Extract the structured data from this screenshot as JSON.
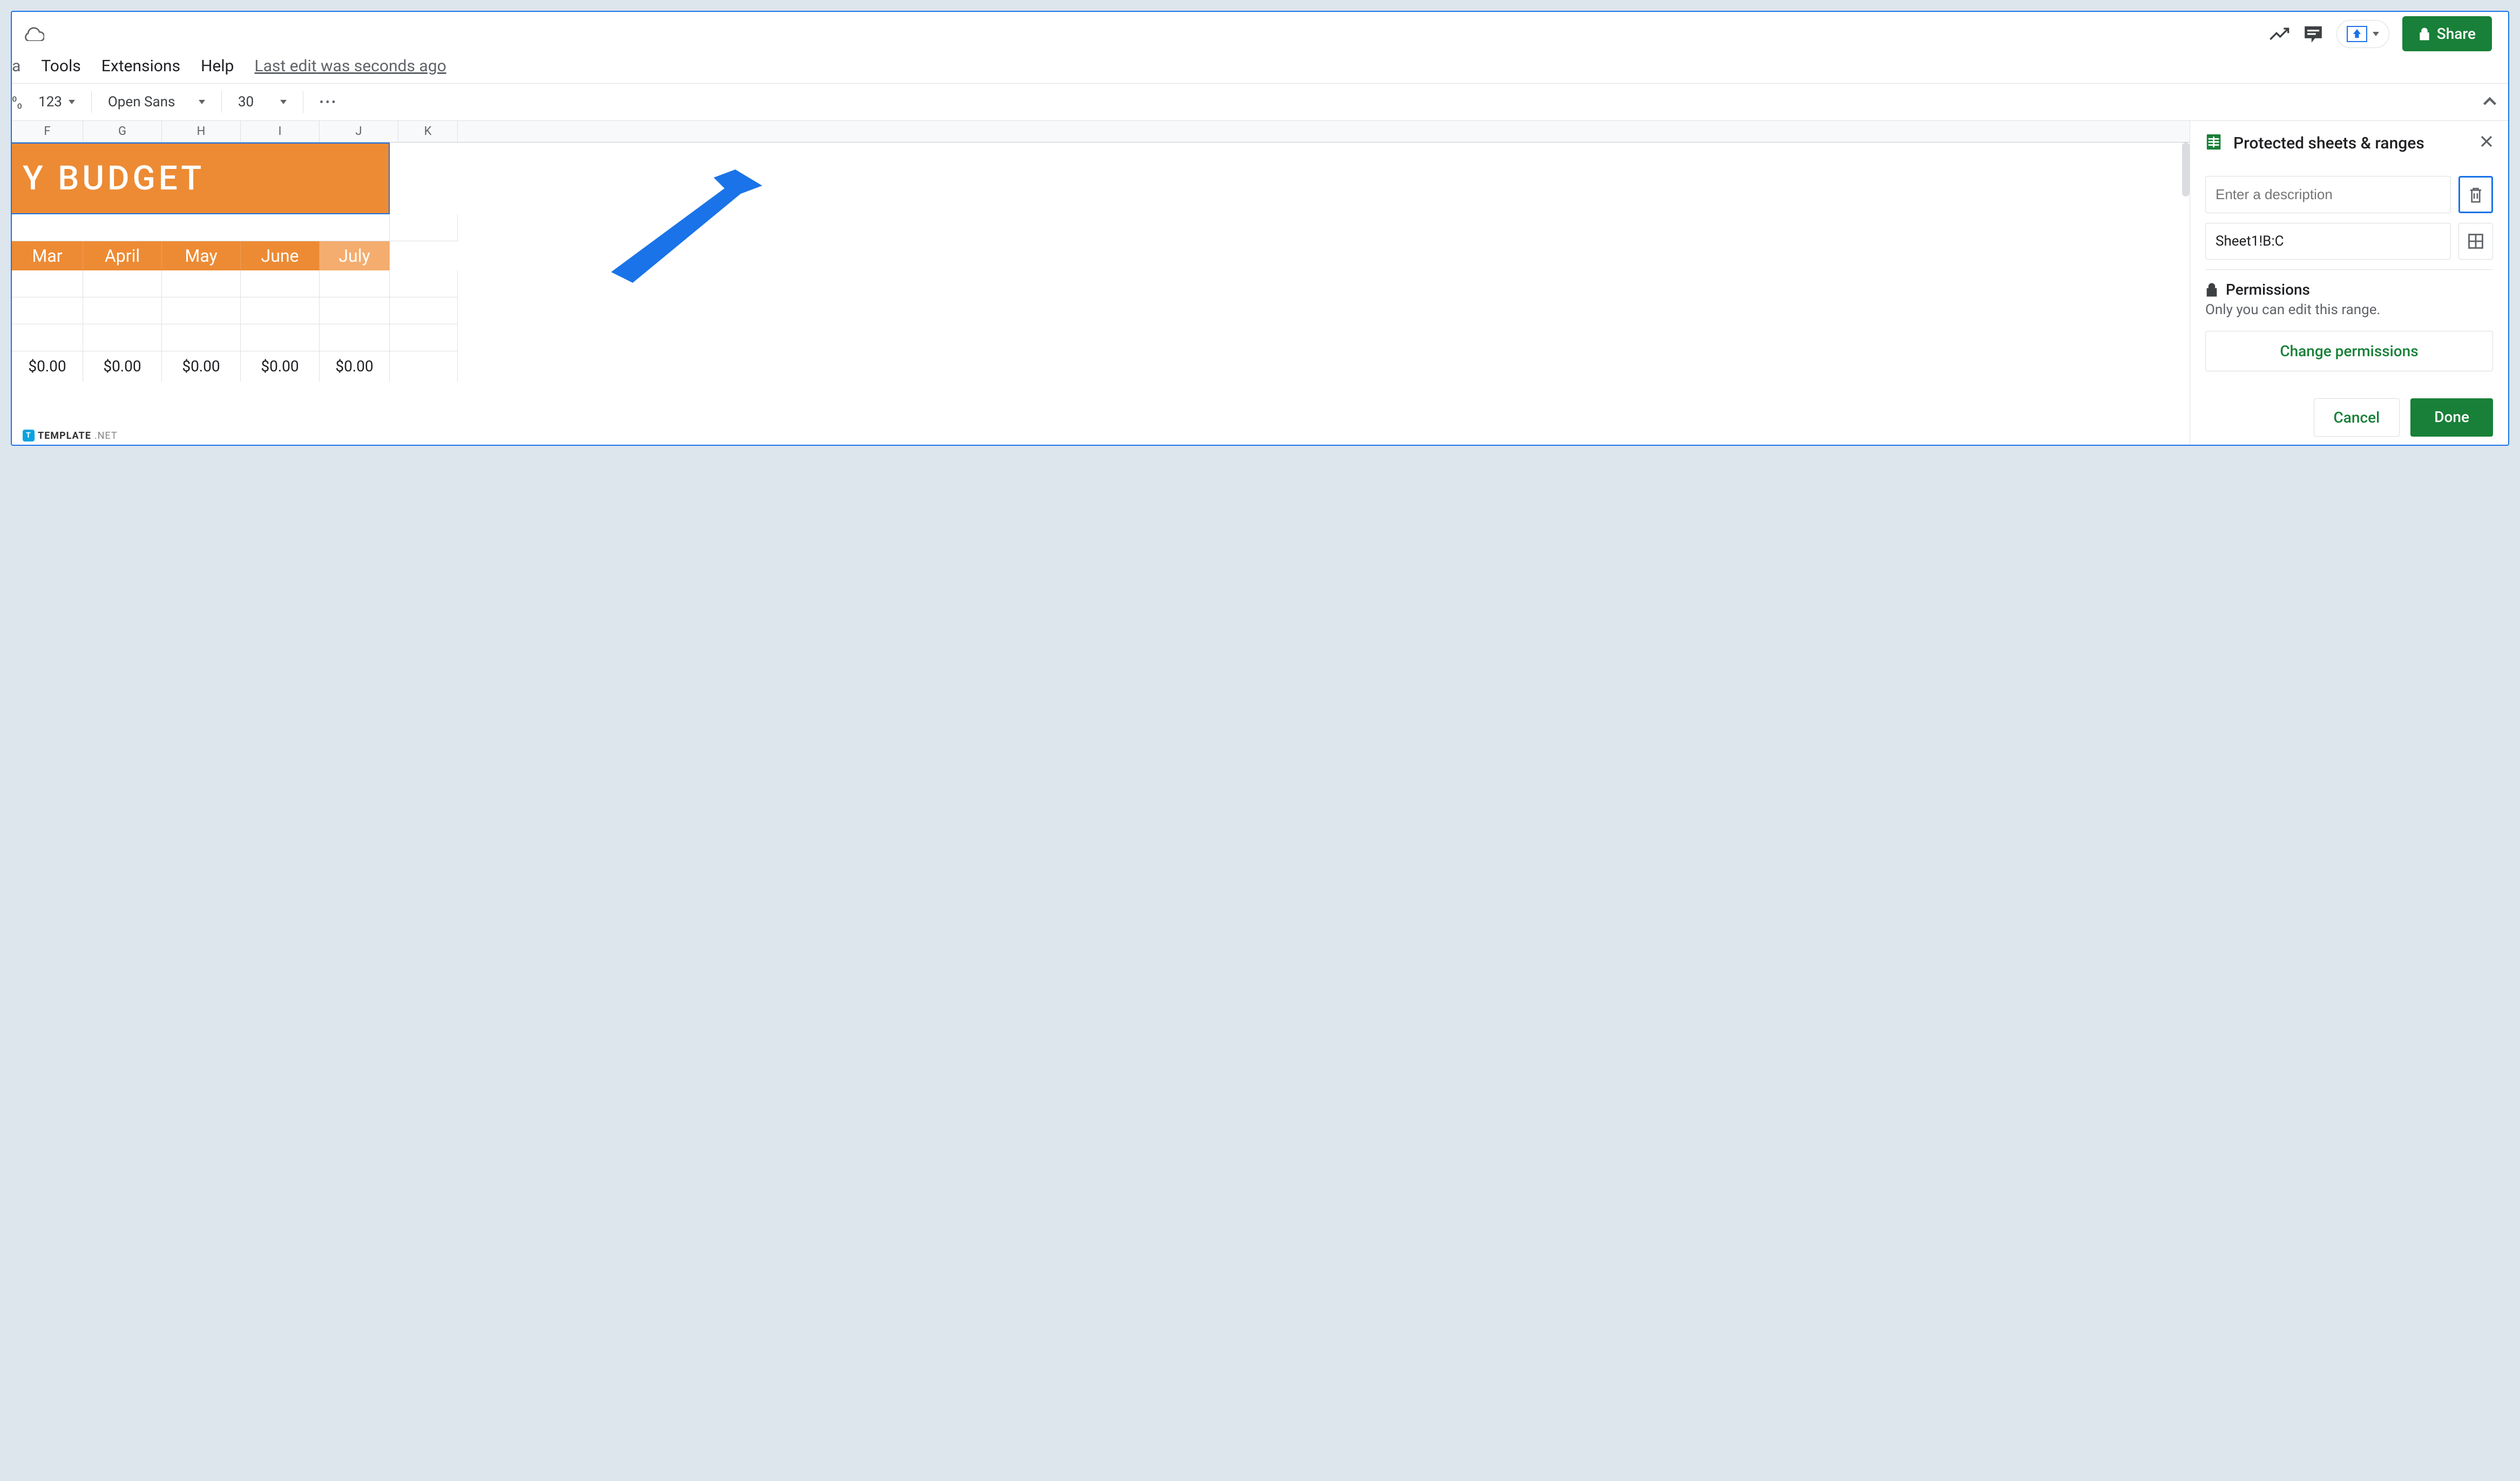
{
  "header": {
    "menu_partial": "a",
    "menus": [
      "Tools",
      "Extensions",
      "Help"
    ],
    "last_edit": "Last edit was seconds ago",
    "share_label": "Share"
  },
  "toolbar": {
    "number_format": "123",
    "font": "Open Sans",
    "font_size": "30"
  },
  "sheet": {
    "columns": [
      "F",
      "G",
      "H",
      "I",
      "J",
      "K"
    ],
    "banner": "Y BUDGET",
    "months": [
      "Mar",
      "April",
      "May",
      "June",
      "July"
    ],
    "totals": [
      "$0.00",
      "$0.00",
      "$0.00",
      "$0.00",
      "$0.00"
    ]
  },
  "panel": {
    "title": "Protected sheets & ranges",
    "description_placeholder": "Enter a description",
    "range_value": "Sheet1!B:C",
    "permissions_label": "Permissions",
    "permissions_desc": "Only you can edit this range.",
    "change_label": "Change permissions",
    "cancel_label": "Cancel",
    "done_label": "Done"
  },
  "watermark": {
    "text": "TEMPLATE",
    "suffix": ".NET"
  }
}
